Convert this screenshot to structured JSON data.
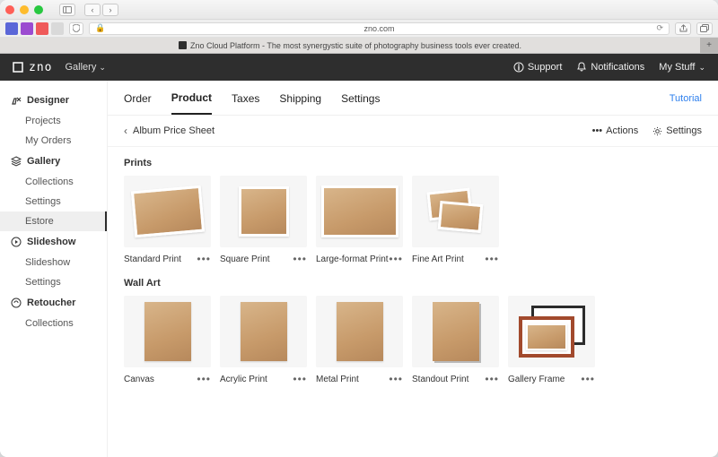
{
  "browser": {
    "url": "zno.com",
    "tab_title": "Zno Cloud Platform - The most synergystic suite of photography business tools ever created."
  },
  "header": {
    "logo": "zno",
    "section_selector": "Gallery",
    "support": "Support",
    "notifications": "Notifications",
    "my_stuff": "My Stuff"
  },
  "sidebar": {
    "groups": [
      {
        "icon": "designer-icon",
        "label": "Designer",
        "items": [
          "Projects",
          "My Orders"
        ]
      },
      {
        "icon": "gallery-icon",
        "label": "Gallery",
        "items": [
          "Collections",
          "Settings",
          "Estore"
        ],
        "active_item": "Estore"
      },
      {
        "icon": "slideshow-icon",
        "label": "Slideshow",
        "items": [
          "Slideshow",
          "Settings"
        ]
      },
      {
        "icon": "retoucher-icon",
        "label": "Retoucher",
        "items": [
          "Collections"
        ]
      }
    ]
  },
  "main_tabs": {
    "items": [
      "Order",
      "Product",
      "Taxes",
      "Shipping",
      "Settings"
    ],
    "active": "Product",
    "tutorial": "Tutorial"
  },
  "page_toolbar": {
    "back_label": "Album Price Sheet",
    "actions_label": "Actions",
    "settings_label": "Settings"
  },
  "sections": [
    {
      "title": "Prints",
      "cards": [
        {
          "label": "Standard Print",
          "thumb": "standard"
        },
        {
          "label": "Square Print",
          "thumb": "square"
        },
        {
          "label": "Large-format Print",
          "thumb": "large"
        },
        {
          "label": "Fine Art Print",
          "thumb": "fineart"
        }
      ]
    },
    {
      "title": "Wall Art",
      "cards": [
        {
          "label": "Canvas",
          "thumb": "tall"
        },
        {
          "label": "Acrylic Print",
          "thumb": "tall"
        },
        {
          "label": "Metal Print",
          "thumb": "tall"
        },
        {
          "label": "Standout Print",
          "thumb": "tall"
        },
        {
          "label": "Gallery Frame",
          "thumb": "gframe"
        }
      ]
    }
  ]
}
